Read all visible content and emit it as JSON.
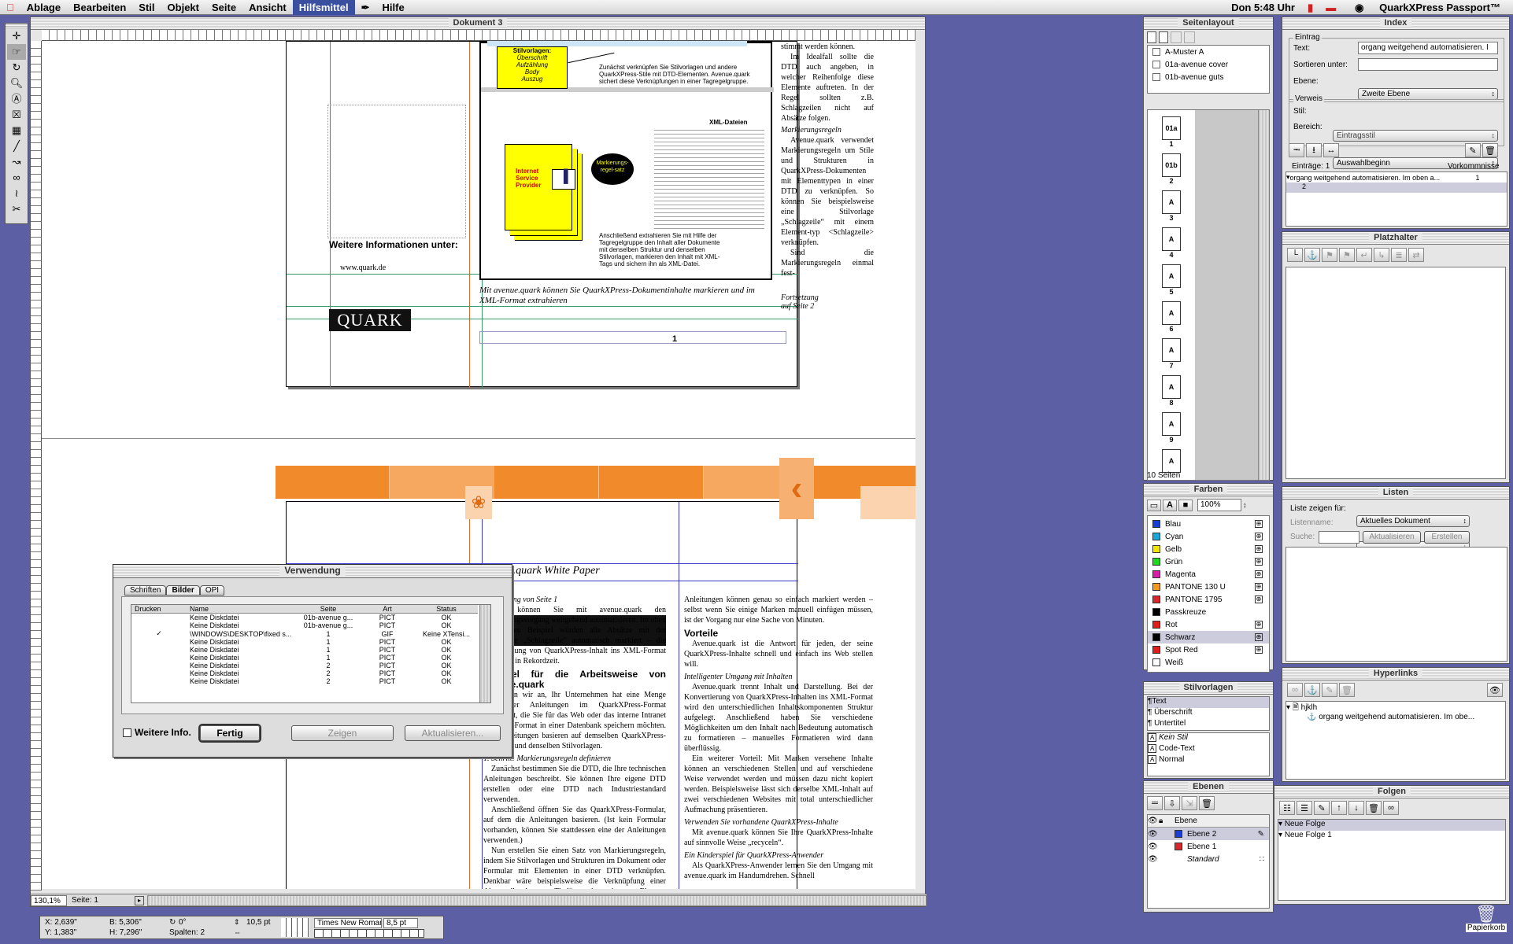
{
  "menubar": {
    "items": [
      "Ablage",
      "Bearbeiten",
      "Stil",
      "Objekt",
      "Seite",
      "Ansicht",
      "Hilfsmittel",
      "Hilfe"
    ],
    "active": "Hilfsmittel",
    "clock": "Don 5:48 Uhr",
    "app": "QuarkXPress Passport™"
  },
  "document": {
    "title": "Dokument 3",
    "zoom": "130,1%",
    "page": "Seite: 1"
  },
  "page_upper": {
    "more_info": "Weitere Informationen unter:",
    "url": "www.quark.de",
    "logo": "QUARK",
    "caption": "Mit avenue.quark können Sie QuarkXPress-Dokumentinhalte markieren und im XML-Format extrahieren",
    "folio": "1",
    "continued": "Fortsetzung auf Seite 2",
    "col_text": [
      "stimmt werden können.",
      "Im Idealfall sollte die DTD auch angeben, in welcher Reihenfolge diese Elemente auftreten. In der Regel sollten z.B. Schlagzeilen nicht auf Absätze folgen."
    ],
    "col_heading": "Markierungsregeln",
    "col_text2": "Avenue.quark verwendet Markierungsregeln um Stile und Strukturen in QuarkXPress-Dokumenten mit Elementtypen in einer DTD zu verknüpfen. So können Sie beispielsweise eine Stilvorlage „Schlagzeile“ mit einem Element-typ <Schlagzeile> verknüpfen.",
    "col_text3": "Sind die Markierungsregeln einmal fest-",
    "fig_labels": [
      "Stilvorlagen:",
      "Überschrift",
      "Aufzählung",
      "Body",
      "Auszug"
    ],
    "fig_text": "Zunächst verknüpfen Sie Stilvorlagen und andere QuarkXPress-Stile mit DTD-Elementen. Avenue.quark sichert diese Verknüpfungen in einer Tagregelgruppe.",
    "fig_xml_title": "XML-Dateien",
    "fig_bubble": "Markierungs-regel-satz",
    "fig_card_title": "Internet Service Provider",
    "fig_bottom_text": "Anschließend extrahieren Sie mit Hilfe der Tagregelgruppe den Inhalt aller Dokumente mit denselben Struktur und denselben Stilvorlagen, markieren den Inhalt mit XML-Tags und sichern ihn als XML-Datei."
  },
  "page_lower": {
    "header": "avenue.quark White Paper",
    "cont_from": "Fortsetzung von Seite 1",
    "col1": [
      "gelegt, können Sie mit avenue.quark den Markierungsvorgang weitgehend automatisieren. Im oben angeführten Beispiel würden alle Absätze mit der Stilvorlage „Schlagzeile“ automatisch markiert – die Umwandlung von QuarkXPress-Inhalt ins XML-Format geschieht in Rekordzeit."
    ],
    "col1_h1": "Beispiel für die Arbeitsweise von avenue.quark",
    "col1_p2": "Nehmen wir an, Ihr Unternehmen hat eine Menge technischer Anleitungen im QuarkXPress-Format produziert, die Sie für das Web oder das interne Intranet im XML-Format in einer Datenbank speichern möchten. Alle Anleitungen basieren auf demselben QuarkXPress-Formular und denselben Stilvorlagen.",
    "col1_h2": "1. Schritt: Markierungsregeln definieren",
    "col1_p3": "Zunächst bestimmen Sie die DTD, die Ihre technischen Anleitungen beschreibt. Sie können Ihre eigene DTD erstellen oder eine DTD nach Industriestandard verwenden.",
    "col1_p4": "Anschließend öffnen Sie das QuarkXPress-Formular, auf dem die Anleitungen basieren. (Ist kein Formular vorhanden, können Sie stattdessen eine der Anleitungen verwenden.)",
    "col1_p5": "Nun erstellen Sie einen Satz von Markierungsregeln, indem Sie Stilvorlagen und Strukturen im Dokument oder Formular mit Elementen in einer DTD verknüpfen. Denkbar wäre beispielsweise die Verknüpfung einer Absatzstilvorlage „Titel“ mit einem Element <Anleitungstitel> um alle Absätze mit",
    "col2_p1": "Anleitungen können genau so einfach markiert werden – selbst wenn Sie einige Marken manuell einfügen müssen, ist der Vorgang nur eine Sache von Minuten.",
    "col2_h1": "Vorteile",
    "col2_p2": "Avenue.quark ist die Antwort für jeden, der seine QuarkXPress-Inhalte schnell und einfach ins Web stellen will.",
    "col2_h2": "Intelligenter Umgang mit Inhalten",
    "col2_p3": "Avenue.quark trennt Inhalt und Darstellung. Bei der Konvertierung von QuarkXPress-Inhalten ins XML-Format wird den unterschiedlichen Inhaltskomponenten Struktur aufgelegt. Anschließend haben Sie verschiedene Möglichkeiten um den Inhalt nach Bedeutung automatisch zu formatieren – manuelles Formatieren wird dann überflüssig.",
    "col2_p4": "Ein weiterer Vorteil: Mit Marken versehene Inhalte können an verschiedenen Stellen und auf verschiedene Weise verwendet werden und müssen dazu nicht kopiert werden. Beispielsweise lässt sich derselbe XML-Inhalt auf zwei verschiedenen Websites mit total unterschiedlicher Aufmachung präsentieren.",
    "col2_h3": "Verwenden Sie vorhandene QuarkXPress-Inhalte",
    "col2_p5": "Mit avenue.quark können Sie Ihre QuarkXPress-Inhalte auf sinnvolle Weise „recyceln“.",
    "col2_h4": "Ein Kinderspiel für QuarkXPress-Anwender",
    "col2_p6": "Als QuarkXPress-Anwender lernen Sie den Umgang mit avenue.quark im Handumdrehen. Schnell"
  },
  "verwendung": {
    "title": "Verwendung",
    "tabs": [
      "Schriften",
      "Bilder",
      "OPI"
    ],
    "active_tab": "Bilder",
    "columns": [
      "Drucken",
      "Name",
      "Seite",
      "Art",
      "Status"
    ],
    "rows": [
      [
        "",
        "Keine Diskdatei",
        "01b-avenue g...",
        "PICT",
        "OK"
      ],
      [
        "",
        "Keine Diskdatei",
        "01b-avenue g...",
        "PICT",
        "OK"
      ],
      [
        "✓",
        "\\WINDOWS\\DESKTOP\\fixed s...",
        "1",
        "GIF",
        "Keine XTensi..."
      ],
      [
        "",
        "Keine Diskdatei",
        "1",
        "PICT",
        "OK"
      ],
      [
        "",
        "Keine Diskdatei",
        "1",
        "PICT",
        "OK"
      ],
      [
        "",
        "Keine Diskdatei",
        "1",
        "PICT",
        "OK"
      ],
      [
        "",
        "Keine Diskdatei",
        "2",
        "PICT",
        "OK"
      ],
      [
        "",
        "Keine Diskdatei",
        "2",
        "PICT",
        "OK"
      ],
      [
        "",
        "Keine Diskdatei",
        "2",
        "PICT",
        "OK"
      ]
    ],
    "more_info": "Weitere Info.",
    "done": "Fertig",
    "show": "Zeigen",
    "update": "Aktualisieren..."
  },
  "seitenlayout": {
    "title": "Seitenlayout",
    "masters": [
      "A-Muster A",
      "01a-avenue cover",
      "01b-avenue guts"
    ],
    "pages": [
      {
        "m": "01a",
        "n": "1"
      },
      {
        "m": "01b",
        "n": "2"
      },
      {
        "m": "A",
        "n": "3"
      },
      {
        "m": "A",
        "n": "4"
      },
      {
        "m": "A",
        "n": "5"
      },
      {
        "m": "A",
        "n": "6"
      },
      {
        "m": "A",
        "n": "7"
      },
      {
        "m": "A",
        "n": "8"
      },
      {
        "m": "A",
        "n": "9"
      },
      {
        "m": "A",
        "n": ""
      }
    ],
    "count": "10 Seiten"
  },
  "farben": {
    "title": "Farben",
    "percent": "100%",
    "colors": [
      {
        "name": "Blau",
        "hex": "#1a3fd6"
      },
      {
        "name": "Cyan",
        "hex": "#19a6d8"
      },
      {
        "name": "Gelb",
        "hex": "#f2e600"
      },
      {
        "name": "Grün",
        "hex": "#1ed81e"
      },
      {
        "name": "Magenta",
        "hex": "#d81ea6"
      },
      {
        "name": "PANTONE 130 U",
        "hex": "#f39a1e"
      },
      {
        "name": "PANTONE 1795",
        "hex": "#d8282d"
      },
      {
        "name": "Passkreuze",
        "hex": "#000000"
      },
      {
        "name": "Rot",
        "hex": "#e01e1e"
      },
      {
        "name": "Schwarz",
        "hex": "#000000"
      },
      {
        "name": "Spot Red",
        "hex": "#e01e1e"
      },
      {
        "name": "Weiß",
        "hex": "#ffffff"
      }
    ],
    "selected": "Schwarz"
  },
  "stilvorlagen": {
    "title": "Stilvorlagen",
    "para": [
      "Text",
      "Überschrift",
      "Untertitel"
    ],
    "char": [
      "Kein Stil",
      "Code-Text",
      "Normal"
    ]
  },
  "ebenen": {
    "title": "Ebenen",
    "header": "Ebene",
    "layers": [
      {
        "name": "Ebene 2",
        "hex": "#1a3fd6"
      },
      {
        "name": "Ebene 1",
        "hex": "#d8282d"
      },
      {
        "name": "Standard",
        "hex": ""
      }
    ]
  },
  "index": {
    "title": "Index",
    "group": "Eintrag",
    "text_label": "Text:",
    "text_value": "organg weitgehend automatisieren. I",
    "sort_label": "Sortieren unter:",
    "level_label": "Ebene:",
    "level_value": "Zweite Ebene",
    "ref_group": "Verweis",
    "style_label": "Stil:",
    "style_value": "Eintragsstil",
    "range_label": "Bereich:",
    "range_value": "Auswahlbeginn",
    "entries": "Einträge: 1",
    "occurrences": "Vorkommnisse",
    "entry_text": "organg weitgehend automatisieren. Im oben a...",
    "entry_count": "1",
    "entry_sub": "2"
  },
  "platzhalter": {
    "title": "Platzhalter"
  },
  "listen": {
    "title": "Listen",
    "show_label": "Liste zeigen für:",
    "show_value": "Aktuelles Dokument",
    "name_label": "Listenname:",
    "search_label": "Suche:",
    "update": "Aktualisieren",
    "build": "Erstellen"
  },
  "hyperlinks": {
    "title": "Hyperlinks",
    "item": "hjklh",
    "sub": "organg weitgehend automatisieren. Im obe..."
  },
  "folgen": {
    "title": "Folgen",
    "items": [
      "Neue Folge",
      "Neue Folge 1"
    ]
  },
  "measure": {
    "x": "X: 2,639\"",
    "y": "Y: 1,383\"",
    "b": "B: 5,306\"",
    "h": "H: 7,296\"",
    "angle": "0°",
    "cols": "Spalten: 2",
    "lead": "10,5 pt",
    "font": "Times New Roman",
    "size": "8,5 pt"
  },
  "desktop": {
    "trash": "Papierkorb"
  }
}
